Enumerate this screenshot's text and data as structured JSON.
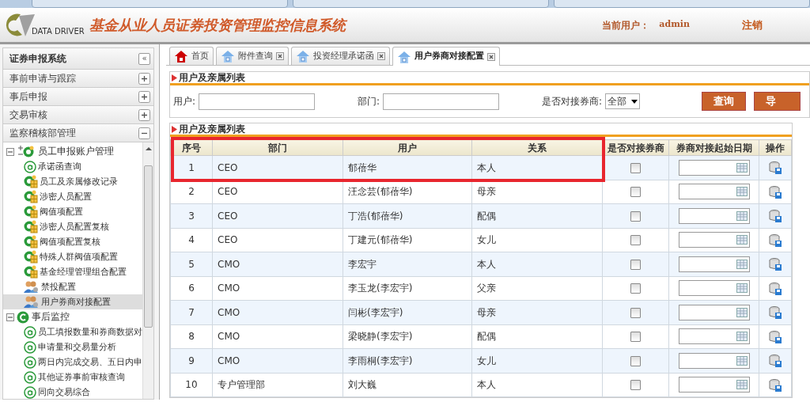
{
  "header": {
    "logo_text": "DATA DRIVER",
    "title": "基金从业人员证券投资管理监控信息系统",
    "user_label": "当前用户：",
    "user_name": "admin",
    "logout": "注销"
  },
  "sidebar": {
    "title": "证券申报系统",
    "collapse_button": "«",
    "sections": [
      {
        "label": "事前申请与跟踪",
        "expanded": false
      },
      {
        "label": "事后申报",
        "expanded": false
      },
      {
        "label": "交易审核",
        "expanded": false
      },
      {
        "label": "监察稽核部管理",
        "expanded": true
      }
    ],
    "tree": [
      {
        "label": "员工申报账户管理",
        "kind": "folder",
        "expanded": true,
        "children": [
          {
            "label": "承诺函查询",
            "kind": "page",
            "selected": false
          },
          {
            "label": "员工及亲属修改记录",
            "kind": "config",
            "selected": false
          },
          {
            "label": "涉密人员配置",
            "kind": "config",
            "selected": false
          },
          {
            "label": "阀值项配置",
            "kind": "config",
            "selected": false
          },
          {
            "label": "涉密人员配置复核",
            "kind": "config",
            "selected": false
          },
          {
            "label": "阀值项配置复核",
            "kind": "config",
            "selected": false
          },
          {
            "label": "特殊人群阀值项配置",
            "kind": "config",
            "selected": false
          },
          {
            "label": "基金经理管理组合配置",
            "kind": "config",
            "selected": false
          },
          {
            "label": "禁投配置",
            "kind": "users",
            "selected": false
          },
          {
            "label": "用户券商对接配置",
            "kind": "users",
            "selected": true
          }
        ]
      },
      {
        "label": "事后监控",
        "kind": "monitor",
        "expanded": true,
        "children": [
          {
            "label": "员工填报数量和券商数据对",
            "kind": "page",
            "selected": false
          },
          {
            "label": "申请量和交易量分析",
            "kind": "page",
            "selected": false
          },
          {
            "label": "两日内完成交易、五日内申",
            "kind": "page",
            "selected": false
          },
          {
            "label": "其他证券事前审核查询",
            "kind": "page",
            "selected": false
          },
          {
            "label": "同向交易综合",
            "kind": "page",
            "selected": false
          }
        ]
      }
    ]
  },
  "tabs": [
    {
      "label": "首页",
      "kind": "home",
      "selected": false
    },
    {
      "label": "附件查询",
      "kind": "page",
      "selected": false
    },
    {
      "label": "投资经理承诺函",
      "kind": "page",
      "selected": false
    },
    {
      "label": "用户券商对接配置",
      "kind": "page",
      "selected": true
    }
  ],
  "search_panel": {
    "title": "用户及亲属列表",
    "fields": [
      {
        "label": "用户:"
      },
      {
        "label": "部门:"
      }
    ],
    "select": {
      "label": "是否对接券商:",
      "value": "全部"
    },
    "buttons": [
      "查询",
      "导"
    ]
  },
  "table": {
    "title": "用户及亲属列表",
    "columns": [
      "序号",
      "部门",
      "用户",
      "关系",
      "是否对接券商",
      "券商对接起始日期",
      "操作"
    ],
    "rows": [
      {
        "no": "1",
        "dept": "CEO",
        "user": "郁蓓华",
        "relation": "本人",
        "linked": false
      },
      {
        "no": "2",
        "dept": "CEO",
        "user": "汪念芸(郁蓓华)",
        "relation": "母亲",
        "linked": false
      },
      {
        "no": "3",
        "dept": "CEO",
        "user": "丁浩(郁蓓华)",
        "relation": "配偶",
        "linked": false
      },
      {
        "no": "4",
        "dept": "CEO",
        "user": "丁建元(郁蓓华)",
        "relation": "女儿",
        "linked": false
      },
      {
        "no": "5",
        "dept": "CMO",
        "user": "李宏宇",
        "relation": "本人",
        "linked": false
      },
      {
        "no": "6",
        "dept": "CMO",
        "user": "李玉龙(李宏宇)",
        "relation": "父亲",
        "linked": false
      },
      {
        "no": "7",
        "dept": "CMO",
        "user": "闫彬(李宏宇)",
        "relation": "母亲",
        "linked": false
      },
      {
        "no": "8",
        "dept": "CMO",
        "user": "梁晓静(李宏宇)",
        "relation": "配偶",
        "linked": false
      },
      {
        "no": "9",
        "dept": "CMO",
        "user": "李雨桐(李宏宇)",
        "relation": "女儿",
        "linked": false
      },
      {
        "no": "10",
        "dept": "专户管理部",
        "user": "刘大巍",
        "relation": "本人",
        "linked": false
      }
    ]
  }
}
